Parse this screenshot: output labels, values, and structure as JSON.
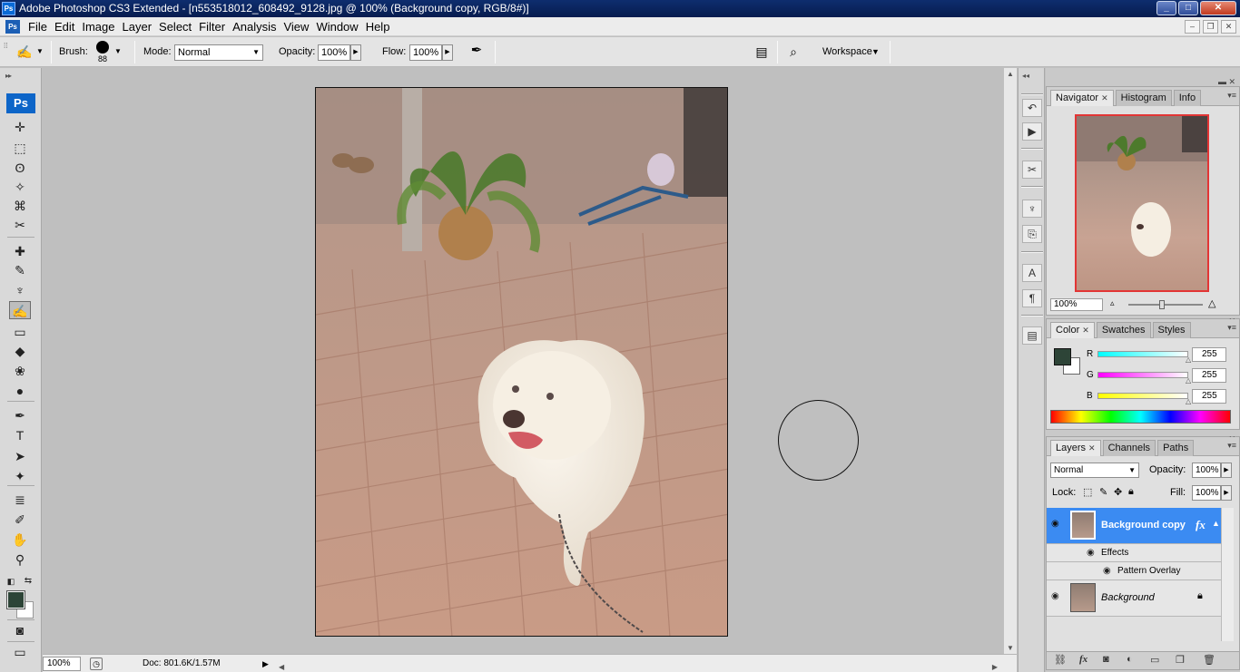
{
  "window": {
    "title": "Adobe Photoshop CS3 Extended - [n553518012_608492_9128.jpg @ 100% (Background copy, RGB/8#)]",
    "app_badge": "Ps",
    "controls": [
      "_",
      "□",
      "✕"
    ]
  },
  "menubar": {
    "items": [
      "File",
      "Edit",
      "Image",
      "Layer",
      "Select",
      "Filter",
      "Analysis",
      "View",
      "Window",
      "Help"
    ],
    "doc_controls": [
      "–",
      "❐",
      "✕"
    ]
  },
  "options": {
    "brush_label": "Brush:",
    "brush_size": "88",
    "mode_label": "Mode:",
    "mode_value": "Normal",
    "opacity_label": "Opacity:",
    "opacity_value": "100%",
    "flow_label": "Flow:",
    "flow_value": "100%",
    "workspace_label": "Workspace"
  },
  "toolbox": {
    "logo": "Ps",
    "tools": [
      {
        "name": "move-tool-icon",
        "glyph": "✛"
      },
      {
        "name": "marquee-tool-icon",
        "glyph": "⬚"
      },
      {
        "name": "lasso-tool-icon",
        "glyph": "ʘ"
      },
      {
        "name": "magic-wand-tool-icon",
        "glyph": "✧"
      },
      {
        "name": "crop-tool-icon",
        "glyph": "⌘"
      },
      {
        "name": "slice-tool-icon",
        "glyph": "✂"
      },
      {
        "name": "healing-brush-tool-icon",
        "glyph": "✚"
      },
      {
        "name": "brush-tool-icon",
        "glyph": "✎"
      },
      {
        "name": "clone-stamp-tool-icon",
        "glyph": "♆"
      },
      {
        "name": "history-brush-tool-icon",
        "glyph": "✍"
      },
      {
        "name": "eraser-tool-icon",
        "glyph": "▭"
      },
      {
        "name": "paint-bucket-tool-icon",
        "glyph": "◆"
      },
      {
        "name": "blur-tool-icon",
        "glyph": "❀"
      },
      {
        "name": "dodge-tool-icon",
        "glyph": "●"
      },
      {
        "name": "pen-tool-icon",
        "glyph": "✒"
      },
      {
        "name": "type-tool-icon",
        "glyph": "T"
      },
      {
        "name": "path-selection-tool-icon",
        "glyph": "➤"
      },
      {
        "name": "custom-shape-tool-icon",
        "glyph": "✦"
      },
      {
        "name": "notes-tool-icon",
        "glyph": "≣"
      },
      {
        "name": "eyedropper-tool-icon",
        "glyph": "✐"
      },
      {
        "name": "hand-tool-icon",
        "glyph": "✋"
      },
      {
        "name": "zoom-tool-icon",
        "glyph": "⚲"
      }
    ],
    "foreground_color": "#2d4437",
    "background_color": "#ffffff"
  },
  "status": {
    "zoom": "100%",
    "doc_info": "Doc: 801.6K/1.57M"
  },
  "navigator": {
    "tabs": [
      "Navigator",
      "Histogram",
      "Info"
    ],
    "zoom": "100%"
  },
  "color_panel": {
    "tabs": [
      "Color",
      "Swatches",
      "Styles"
    ],
    "channels": [
      {
        "label": "R",
        "value": "255",
        "gradient": "linear-gradient(90deg,#00ffff,#ffffff)"
      },
      {
        "label": "G",
        "value": "255",
        "gradient": "linear-gradient(90deg,#ff00ff,#ffffff)"
      },
      {
        "label": "B",
        "value": "255",
        "gradient": "linear-gradient(90deg,#ffff00,#ffffff)"
      }
    ]
  },
  "layers_panel": {
    "tabs": [
      "Layers",
      "Channels",
      "Paths"
    ],
    "blend_mode": "Normal",
    "opacity_label": "Opacity:",
    "opacity_value": "100%",
    "lock_label": "Lock:",
    "fill_label": "Fill:",
    "fill_value": "100%",
    "layers": [
      {
        "name": "Background copy",
        "fx": "fx",
        "selected": true
      },
      {
        "name": "Effects"
      },
      {
        "name": "Pattern Overlay"
      },
      {
        "name": "Background",
        "locked": true
      }
    ]
  },
  "accent_color": "#3b8bf2"
}
